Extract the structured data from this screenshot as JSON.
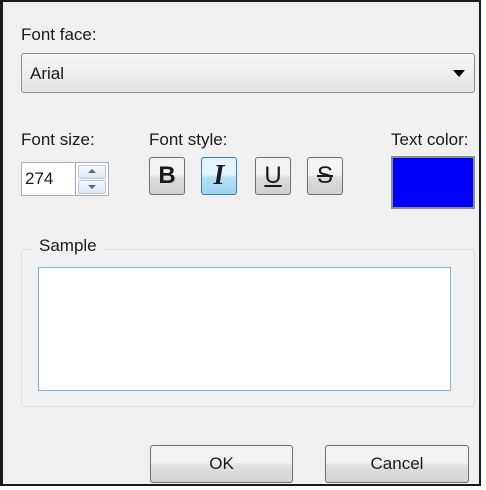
{
  "dialog": {
    "font_face_label": "Font face:",
    "font_face_value": "Arial",
    "font_size_label": "Font size:",
    "font_size_value": "274",
    "font_style_label": "Font style:",
    "text_color_label": "Text color:",
    "text_color": "#0000ff",
    "style_buttons": {
      "bold": "B",
      "italic": "I",
      "underline": "U",
      "strikethrough": "S",
      "active": "italic"
    },
    "sample_label": "Sample",
    "sample_text": "",
    "ok_label": "OK",
    "cancel_label": "Cancel"
  }
}
